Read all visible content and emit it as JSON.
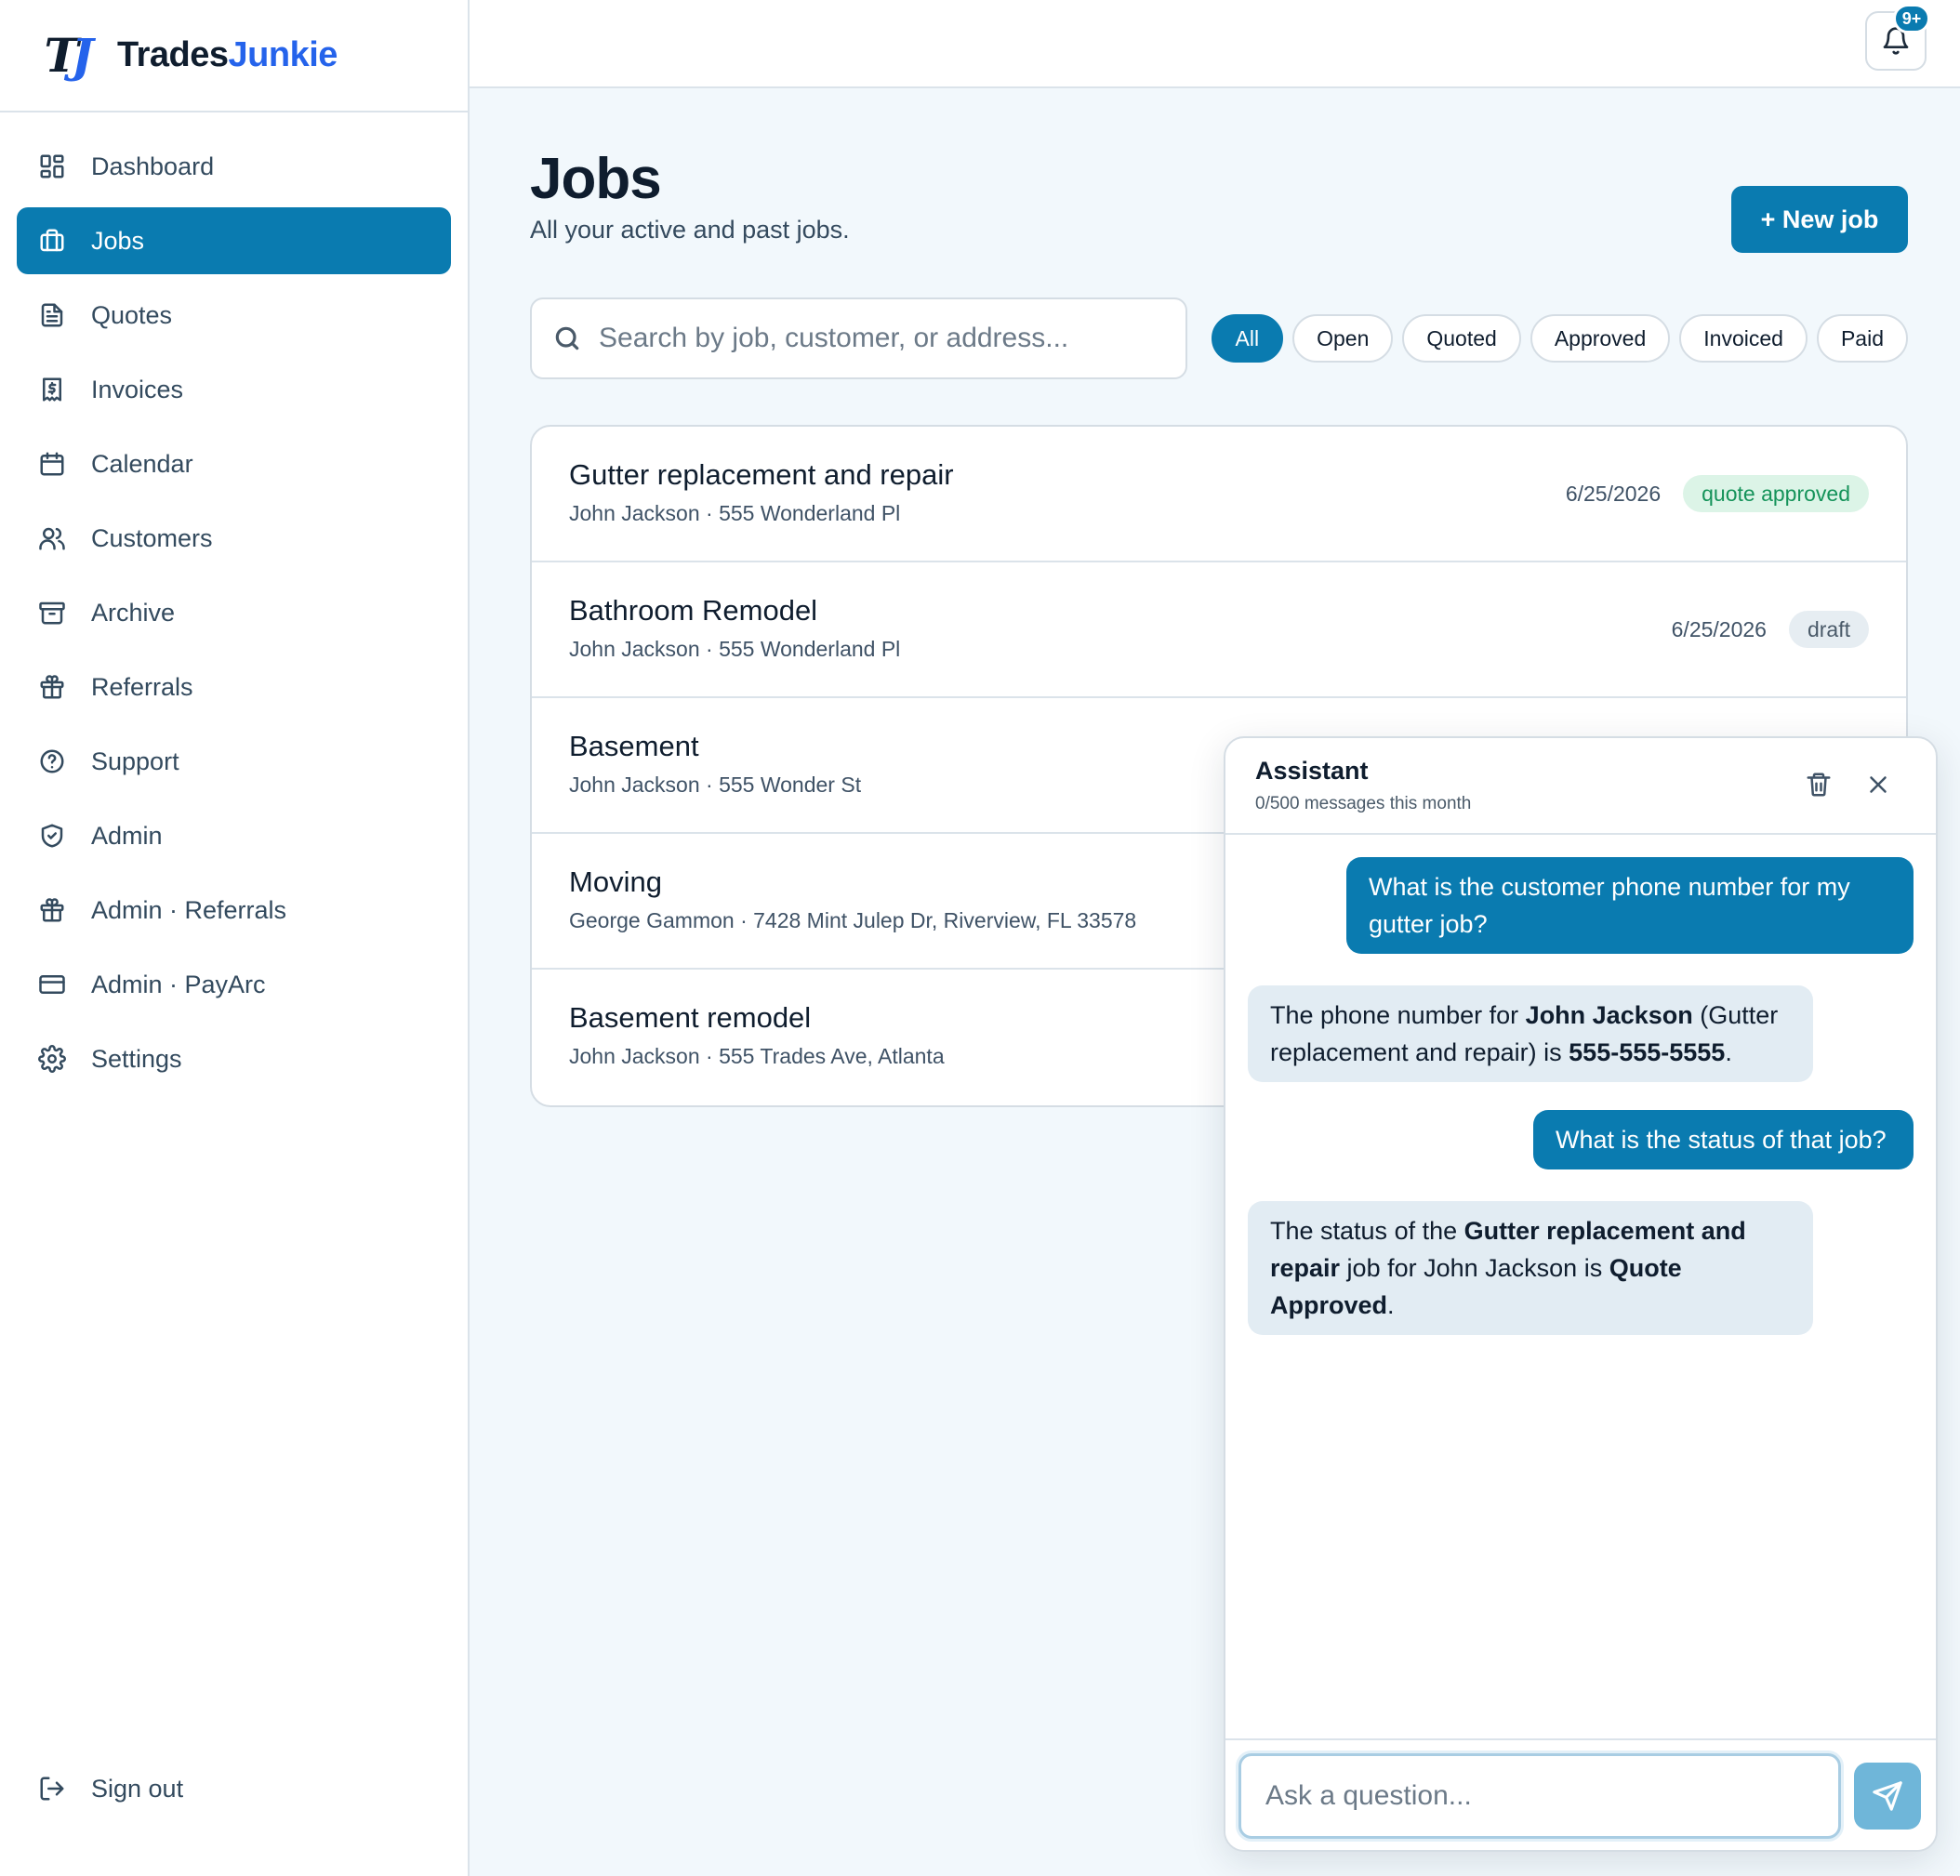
{
  "brand": {
    "logo": "TJ",
    "name_part1": "Trades",
    "name_part2": "Junkie"
  },
  "sidebar": {
    "items": [
      {
        "label": "Dashboard",
        "icon": "grid-icon"
      },
      {
        "label": "Jobs",
        "icon": "briefcase-icon",
        "active": true
      },
      {
        "label": "Quotes",
        "icon": "file-text-icon"
      },
      {
        "label": "Invoices",
        "icon": "receipt-icon"
      },
      {
        "label": "Calendar",
        "icon": "calendar-icon"
      },
      {
        "label": "Customers",
        "icon": "users-icon"
      },
      {
        "label": "Archive",
        "icon": "archive-icon"
      },
      {
        "label": "Referrals",
        "icon": "gift-icon"
      },
      {
        "label": "Support",
        "icon": "help-circle-icon"
      },
      {
        "label": "Admin",
        "icon": "shield-check-icon"
      },
      {
        "label": "Admin · Referrals",
        "icon": "gift-icon"
      },
      {
        "label": "Admin · PayArc",
        "icon": "credit-card-icon"
      },
      {
        "label": "Settings",
        "icon": "gear-icon"
      }
    ],
    "signout": {
      "label": "Sign out",
      "icon": "log-out-icon"
    }
  },
  "topbar": {
    "notification_badge": "9+"
  },
  "page": {
    "title": "Jobs",
    "subtitle": "All your active and past jobs.",
    "new_job_label": "+ New job",
    "search_placeholder": "Search by job, customer, or address..."
  },
  "filters": [
    {
      "label": "All",
      "active": true
    },
    {
      "label": "Open"
    },
    {
      "label": "Quoted"
    },
    {
      "label": "Approved"
    },
    {
      "label": "Invoiced"
    },
    {
      "label": "Paid"
    }
  ],
  "jobs": [
    {
      "title": "Gutter replacement and repair",
      "meta": "John Jackson · 555 Wonderland Pl",
      "date": "6/25/2026",
      "status": "quote approved"
    },
    {
      "title": "Bathroom Remodel",
      "meta": "John Jackson · 555 Wonderland Pl",
      "date": "6/25/2026",
      "status": "draft"
    },
    {
      "title": "Basement",
      "meta": "John Jackson · 555 Wonder St"
    },
    {
      "title": "Moving",
      "meta": "George Gammon · 7428 Mint Julep Dr, Riverview, FL 33578"
    },
    {
      "title": "Basement remodel",
      "meta": "John Jackson · 555 Trades Ave, Atlanta"
    }
  ],
  "assistant": {
    "title": "Assistant",
    "usage": "0/500 messages this month",
    "messages": [
      {
        "role": "user",
        "text": "What is the customer phone number for my gutter job?"
      },
      {
        "role": "bot",
        "parts": [
          "The phone number for ",
          "John Jackson",
          " (Gutter replacement and repair) is ",
          "555-555-5555",
          "."
        ]
      },
      {
        "role": "user",
        "text": "What is the status of that job?"
      },
      {
        "role": "bot",
        "parts": [
          "The status of the ",
          "Gutter replacement and repair",
          " job for John Jackson is ",
          "Quote Approved",
          "."
        ]
      }
    ],
    "input_placeholder": "Ask a question..."
  },
  "colors": {
    "accent": "#0a7bb0",
    "brand_blue": "#2563eb",
    "approved_green": "#15935a",
    "background": "#f2f8fc"
  }
}
